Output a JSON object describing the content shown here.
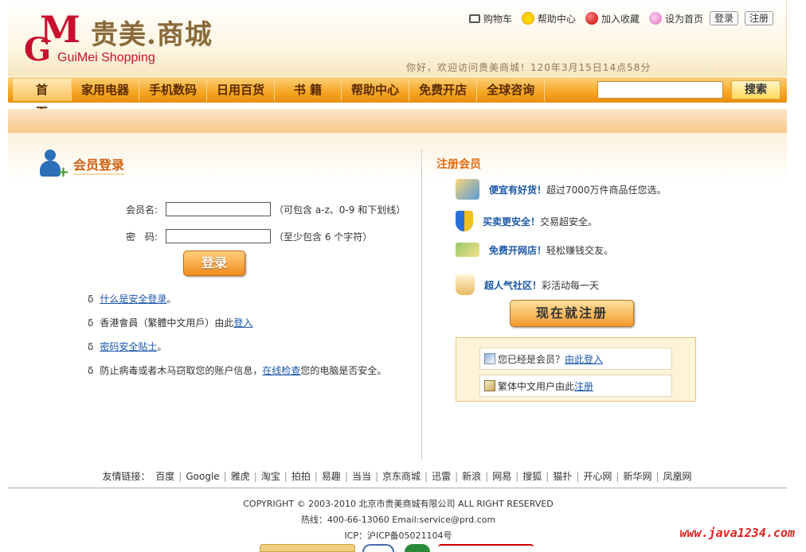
{
  "header": {
    "logo_mark": "M",
    "logo_mark_g": "G",
    "logo_name": "贵美.商城",
    "logo_sub": "GuiMei Shopping",
    "top_links": [
      "购物车",
      "帮助中心",
      "加入收藏",
      "设为首页"
    ],
    "login_btn": "登录",
    "register_btn": "注册",
    "welcome": "你好，欢迎访问贵美商城！120年3月15日14点58分"
  },
  "nav": {
    "items": [
      "首页",
      "家用电器",
      "手机数码",
      "日用百货",
      "书 籍",
      "帮助中心",
      "免费开店",
      "全球咨询"
    ],
    "search_value": "",
    "search_button": "搜索"
  },
  "login": {
    "title": "会员登录",
    "username_label": "会员名:",
    "username_value": "",
    "username_hint": "（可包含 a-z、0-9 和下划线）",
    "password_label": "密　码:",
    "password_value": "",
    "password_hint": "（至少包含 6 个字符）",
    "submit": "登录",
    "tips": [
      {
        "bullet": "δ",
        "pre": "",
        "link": "什么是安全登录",
        "post": "。"
      },
      {
        "bullet": "δ",
        "pre": "香港會員（繁體中文用戶）由此",
        "link": "登入",
        "post": ""
      },
      {
        "bullet": "δ",
        "pre": "",
        "link": "密码安全贴士",
        "post": "。"
      },
      {
        "bullet": "δ",
        "pre": "防止病毒或者木马窃取您的账户信息，",
        "link": "在线检查",
        "post": "您的电脑是否安全。"
      }
    ]
  },
  "register": {
    "title": "注册会员",
    "items": [
      {
        "key": "便宜有好货！",
        "text": "超过7000万件商品任您选。",
        "icon": "hand-bag-icon"
      },
      {
        "key": "买卖更安全！",
        "text": "交易超安全。",
        "icon": "shield-icon"
      },
      {
        "key": "免费开网店！",
        "text": "轻松赚钱交友。",
        "icon": "money-icon"
      },
      {
        "key": "超人气社区！",
        "text": "彩活动每一天",
        "icon": "coffee-icon"
      }
    ],
    "register_button": "现在就注册",
    "member_pre": "您已经是会员？",
    "member_link": "由此登入",
    "trad_pre": "繁体中文用户由此",
    "trad_link": "注册"
  },
  "footer": {
    "links_label": "友情链接：",
    "links": [
      "百度",
      "Google",
      "雅虎",
      "淘宝",
      "拍拍",
      "易趣",
      "当当",
      "京东商城",
      "迅雷",
      "新浪",
      "网易",
      "搜狐",
      "猫扑",
      "开心网",
      "新华网",
      "凤凰网"
    ],
    "copyright": "COPYRIGHT © 2003-2010 北京市贵美商城有限公司 ALL RIGHT RESERVED",
    "hotline": "热线：400-66-13060 Email:service@prd.com",
    "icp": "ICP：沪ICP备05021104号",
    "watermark": "www.java1234.com"
  },
  "colors": {
    "accent": "#f5a623",
    "brand_red": "#c8102e",
    "link_blue": "#1a57a8",
    "title_orange": "#e06a10"
  }
}
